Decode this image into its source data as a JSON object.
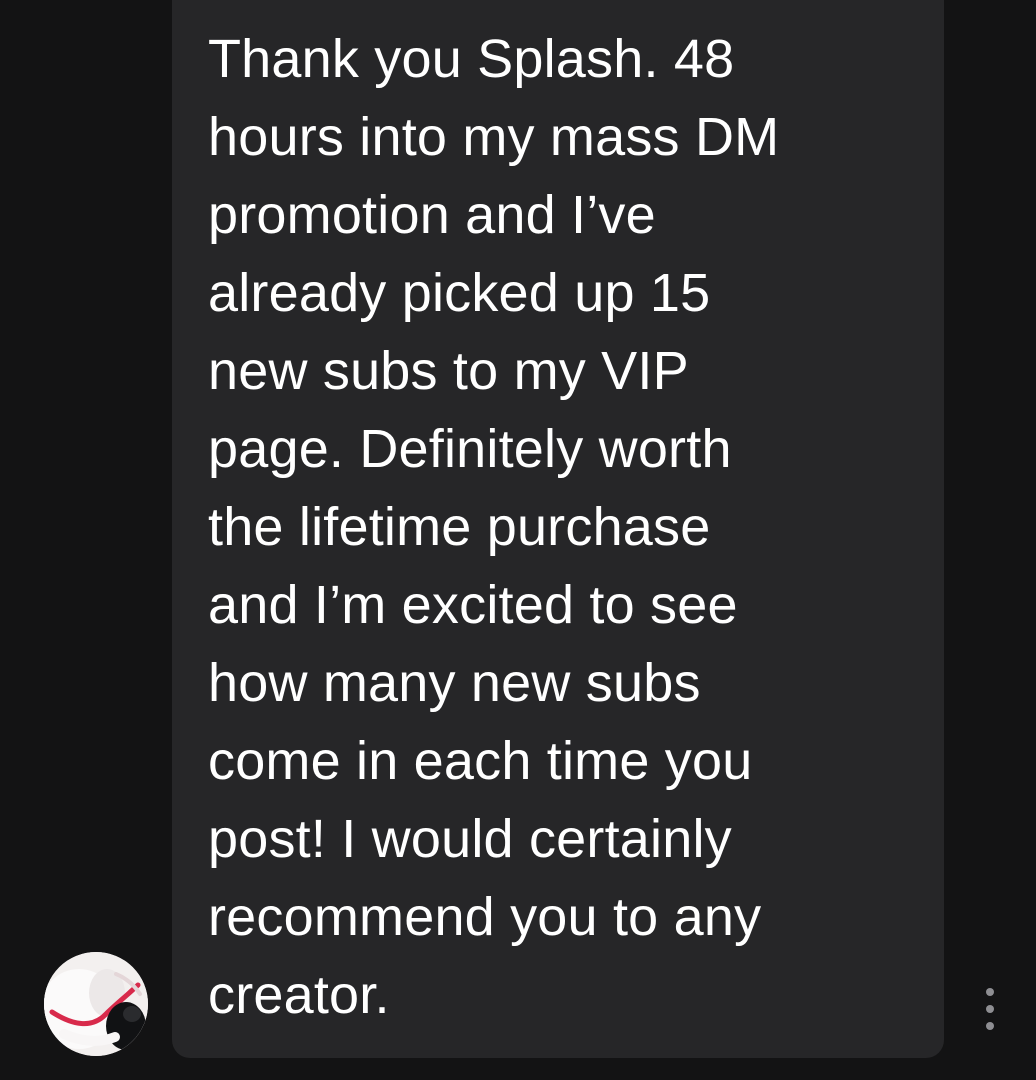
{
  "message": {
    "text": "Thank you Splash. 48\nhours into my mass DM\npromotion and I’ve\nalready picked up 15\nnew subs to my VIP\npage. Definitely worth\nthe lifetime purchase\nand I’m excited to see\nhow many new subs\ncome in each time you\npost! I would certainly\nrecommend you to any\ncreator."
  },
  "colors": {
    "background": "#131314",
    "bubble": "#262628",
    "text": "#ffffff",
    "more_dots": "#8e8e92"
  },
  "icons": {
    "avatar": "profile-photo",
    "more": "vertical-ellipsis-icon"
  }
}
